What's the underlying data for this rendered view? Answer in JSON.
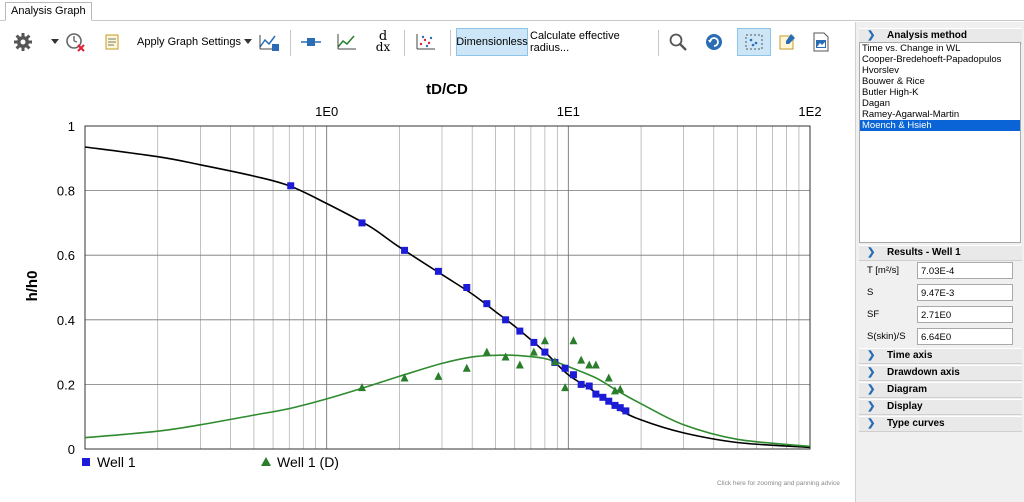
{
  "window": {
    "tab_label": "Analysis Graph"
  },
  "toolbar": {
    "apply_settings_label": "Apply Graph Settings",
    "dimensionless_label": "Dimensionless",
    "calc_radius_label": "Calculate effective radius...",
    "derivative_symbol_top": "d",
    "derivative_symbol_bottom": "dx"
  },
  "panel": {
    "analysis_method_title": "Analysis method",
    "methods": [
      "Time vs. Change in WL",
      "Cooper-Bredehoeft-Papadopulos",
      "Hvorslev",
      "Bouwer & Rice",
      "Butler High-K",
      "Dagan",
      "Ramey-Agarwal-Martin",
      "Moench & Hsieh"
    ],
    "selected_method": "Moench & Hsieh",
    "results_title": "Results - Well 1",
    "results": [
      {
        "label": "T [m²/s]",
        "value": "7.03E-4"
      },
      {
        "label": "S",
        "value": "9.47E-3"
      },
      {
        "label": "SF",
        "value": "2.71E0"
      },
      {
        "label": "S(skin)/S",
        "value": "6.64E0"
      }
    ],
    "collapsed_sections": [
      "Time axis",
      "Drawdown axis",
      "Diagram",
      "Display",
      "Type curves"
    ]
  },
  "status": {
    "advice": "Click here for zooming and panning advice"
  },
  "colors": {
    "accent": "#0a64d6",
    "well1": "#1c1cd6",
    "well1_d": "#2a7d2a",
    "curve_black": "#000000",
    "curve_green": "#2e8b2e"
  },
  "chart_data": {
    "type": "scatter",
    "xlabel": "tD/CD",
    "ylabel": "h/h0",
    "x_scale": "log",
    "xlim": [
      0.1,
      100
    ],
    "ylim": [
      0,
      1
    ],
    "x_ticks": [
      "1E0",
      "1E1",
      "1E2"
    ],
    "y_ticks": [
      "0",
      "0.2",
      "0.4",
      "0.6",
      "0.8",
      "1"
    ],
    "grid": true,
    "legend_position": "bottom-left",
    "series": [
      {
        "name": "Well 1",
        "marker": "square",
        "points": [
          [
            0.71,
            0.815
          ],
          [
            1.4,
            0.7
          ],
          [
            2.1,
            0.615
          ],
          [
            2.9,
            0.55
          ],
          [
            3.8,
            0.5
          ],
          [
            4.6,
            0.45
          ],
          [
            5.5,
            0.4
          ],
          [
            6.3,
            0.365
          ],
          [
            7.2,
            0.33
          ],
          [
            8.0,
            0.3
          ],
          [
            8.8,
            0.268
          ],
          [
            9.7,
            0.25
          ],
          [
            10.5,
            0.23
          ],
          [
            11.3,
            0.2
          ],
          [
            12.2,
            0.195
          ],
          [
            13.0,
            0.17
          ],
          [
            13.9,
            0.16
          ],
          [
            14.7,
            0.148
          ],
          [
            15.6,
            0.135
          ],
          [
            16.4,
            0.128
          ],
          [
            17.3,
            0.118
          ]
        ]
      },
      {
        "name": "Well 1 (D)",
        "marker": "triangle",
        "points": [
          [
            1.4,
            0.19
          ],
          [
            2.1,
            0.22
          ],
          [
            2.9,
            0.225
          ],
          [
            3.8,
            0.25
          ],
          [
            4.6,
            0.3
          ],
          [
            5.5,
            0.285
          ],
          [
            6.3,
            0.26
          ],
          [
            7.2,
            0.3
          ],
          [
            8.0,
            0.335
          ],
          [
            8.8,
            0.27
          ],
          [
            9.7,
            0.19
          ],
          [
            10.5,
            0.335
          ],
          [
            11.3,
            0.275
          ],
          [
            12.2,
            0.26
          ],
          [
            13.0,
            0.26
          ],
          [
            14.7,
            0.22
          ],
          [
            15.6,
            0.18
          ],
          [
            16.4,
            0.185
          ]
        ]
      },
      {
        "name": "type curve",
        "line": true,
        "color": "black",
        "points": [
          [
            0.1,
            0.935
          ],
          [
            0.2,
            0.905
          ],
          [
            0.3,
            0.88
          ],
          [
            0.5,
            0.845
          ],
          [
            0.7,
            0.815
          ],
          [
            1.0,
            0.76
          ],
          [
            1.5,
            0.69
          ],
          [
            2.0,
            0.625
          ],
          [
            3.0,
            0.54
          ],
          [
            4.0,
            0.48
          ],
          [
            5.0,
            0.425
          ],
          [
            6.0,
            0.38
          ],
          [
            8.0,
            0.3
          ],
          [
            10.0,
            0.23
          ],
          [
            13.0,
            0.175
          ],
          [
            16.0,
            0.125
          ],
          [
            20.0,
            0.09
          ],
          [
            30.0,
            0.05
          ],
          [
            50.0,
            0.02
          ],
          [
            100.0,
            0.005
          ]
        ]
      },
      {
        "name": "derivative curve",
        "line": true,
        "color": "green",
        "points": [
          [
            0.1,
            0.035
          ],
          [
            0.2,
            0.055
          ],
          [
            0.3,
            0.075
          ],
          [
            0.5,
            0.105
          ],
          [
            0.7,
            0.125
          ],
          [
            1.0,
            0.155
          ],
          [
            1.5,
            0.195
          ],
          [
            2.0,
            0.225
          ],
          [
            3.0,
            0.265
          ],
          [
            4.0,
            0.285
          ],
          [
            5.0,
            0.29
          ],
          [
            6.0,
            0.29
          ],
          [
            8.0,
            0.28
          ],
          [
            10.0,
            0.255
          ],
          [
            13.0,
            0.22
          ],
          [
            16.0,
            0.18
          ],
          [
            20.0,
            0.14
          ],
          [
            30.0,
            0.075
          ],
          [
            50.0,
            0.03
          ],
          [
            100.0,
            0.008
          ]
        ]
      }
    ]
  }
}
